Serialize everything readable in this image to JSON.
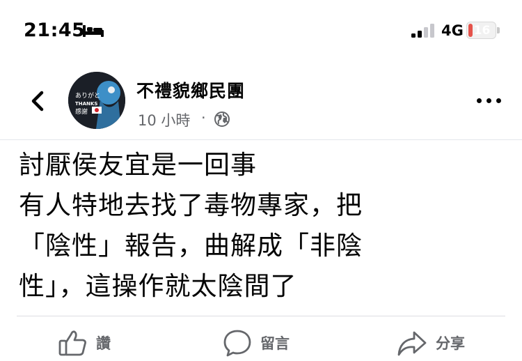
{
  "status_bar": {
    "time": "21:45",
    "network": "4G",
    "battery_level": "16",
    "battery_fraction": 0.16,
    "battery_color": "#e5534b",
    "icons": [
      "bed-icon",
      "cellular-signal-icon",
      "battery-icon"
    ]
  },
  "post": {
    "page_name": "不禮貌鄉民團",
    "time_ago": "10 小時",
    "separator": "·",
    "audience_icon": "globe-icon",
    "avatar_text": {
      "line1": "ありがと",
      "line2": "THANKS",
      "line3": "感謝"
    },
    "body_lines": [
      "討厭侯友宜是一回事",
      "有人特地去找了毒物專家，把",
      "「陰性」報告，曲解成「非陰",
      "性」，這操作就太陰間了"
    ]
  },
  "actions": {
    "like_label": "讚",
    "comment_label": "留言",
    "share_label": "分享"
  },
  "colors": {
    "text_primary": "#050505",
    "text_secondary": "#65676b",
    "divider": "#e4e6eb"
  }
}
